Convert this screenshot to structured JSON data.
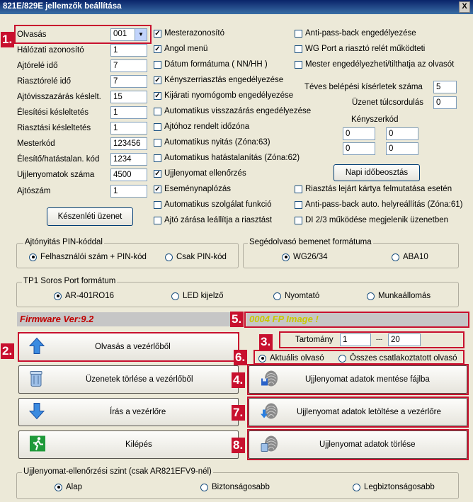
{
  "window": {
    "title": "821E/829E jellemzők beállítása",
    "close": "X"
  },
  "fields": [
    {
      "label": "Olvasás",
      "value": "001"
    },
    {
      "label": "Hálózati azonosító",
      "value": "1"
    },
    {
      "label": "Ajtórelé idő",
      "value": "7"
    },
    {
      "label": "Riasztórelé idő",
      "value": "7"
    },
    {
      "label": "Ajtóvisszazárás késlelt.",
      "value": "15"
    },
    {
      "label": "Élesítési késleltetés",
      "value": "1"
    },
    {
      "label": "Riasztási késleltetés",
      "value": "1"
    },
    {
      "label": "Mesterkód",
      "value": "123456"
    },
    {
      "label": "Élesítő/hatástalan. kód",
      "value": "1234"
    },
    {
      "label": "Ujjlenyomatok száma",
      "value": "4500"
    },
    {
      "label": "Ajtószám",
      "value": "1"
    }
  ],
  "checks_mid": [
    {
      "label": "Mesterazonosító",
      "checked": true
    },
    {
      "label": "Angol menü",
      "checked": true
    },
    {
      "label": "Dátum formátuma ( NN/HH )",
      "checked": false
    },
    {
      "label": "Kényszerriasztás engedélyezése",
      "checked": true
    },
    {
      "label": "Kijárati nyomógomb engedélyezése",
      "checked": true
    },
    {
      "label": "Automatikus visszazárás engedélyezése",
      "checked": false
    },
    {
      "label": "Ajtóhoz rendelt időzóna",
      "checked": false
    },
    {
      "label": "Automatikus nyitás (Zóna:63)",
      "checked": false
    },
    {
      "label": "Automatikus hatástalanítás (Zóna:62)",
      "checked": false
    },
    {
      "label": "Ujjlenyomat ellenőrzés",
      "checked": true
    },
    {
      "label": "Eseménynaplózás",
      "checked": true
    },
    {
      "label": "Automatikus szolgálat funkció",
      "checked": false
    },
    {
      "label": "Ajtó zárása leállítja a riasztást",
      "checked": false
    }
  ],
  "checks_right_top": [
    {
      "label": "Anti-pass-back engedélyezése",
      "checked": false
    },
    {
      "label": "WG Port a riasztó relét működteti",
      "checked": false
    },
    {
      "label": "Mester engedélyezheti/tilthatja az olvasót",
      "checked": false
    }
  ],
  "retry": {
    "label": "Téves belépési kísérletek száma",
    "value": "5"
  },
  "overflow": {
    "label": "Üzenet túlcsordulás",
    "value": "0"
  },
  "duress": {
    "label": "Kényszerkód",
    "values": [
      "0",
      "0",
      "0",
      "0"
    ]
  },
  "daily_button": "Napi időbeosztás",
  "standby_button": "Készenléti üzenet",
  "checks_right_bottom": [
    {
      "label": "Riasztás lejárt kártya felmutatása esetén",
      "checked": false
    },
    {
      "label": "Anti-pass-back auto. helyreállítás (Zóna:61)",
      "checked": false
    },
    {
      "label": "DI 2/3 működése megjelenik üzenetben",
      "checked": false
    }
  ],
  "pin_group": {
    "title": "Ajtónyitás PIN-kóddal",
    "options": [
      "Felhasználói szám + PIN-kód",
      "Csak PIN-kód"
    ],
    "selected": 0
  },
  "aux_group": {
    "title": "Segédolvasó bemenet formátuma",
    "options": [
      "WG26/34",
      "ABA10"
    ],
    "selected": 0
  },
  "tp1_group": {
    "title": "TP1 Soros Port formátum",
    "options": [
      "AR-401RO16",
      "LED kijelző",
      "Nyomtató",
      "Munkaállomás"
    ],
    "selected": 0
  },
  "firmware": "Firmware Ver:9.2",
  "fp_image": "0004 FP Image !",
  "range": {
    "label": "Tartomány",
    "from": "1",
    "sep": "---",
    "to": "20"
  },
  "reader_scope": {
    "options": [
      "Aktuális olvasó",
      "Összes csatlakoztatott olvasó"
    ],
    "selected": 0
  },
  "buttons_left": [
    "Olvasás a vezérlőből",
    "Üzenetek törlése a vezérlőből",
    "Írás a vezérlőre",
    "Kilépés"
  ],
  "buttons_right": [
    "Ujjlenyomat adatok mentése fájlba",
    "Ujjlenyomat adatok letöltése a vezérlőre",
    "Ujjlenyomat adatok törlése"
  ],
  "fp_level_group": {
    "title": "Ujjlenyomat-ellenőrzési szint (csak AR821EFV9-nél)",
    "options": [
      "Alap",
      "Biztonságosabb",
      "Legbiztonságosabb"
    ],
    "selected": 0
  },
  "callouts": [
    "1.",
    "2.",
    "3.",
    "4.",
    "5.",
    "6.",
    "7.",
    "8."
  ],
  "colors": {
    "callout": "#c8102e",
    "firmware": "#c00000",
    "fp_image": "#c8c800",
    "title_bar": "#0a246a"
  }
}
